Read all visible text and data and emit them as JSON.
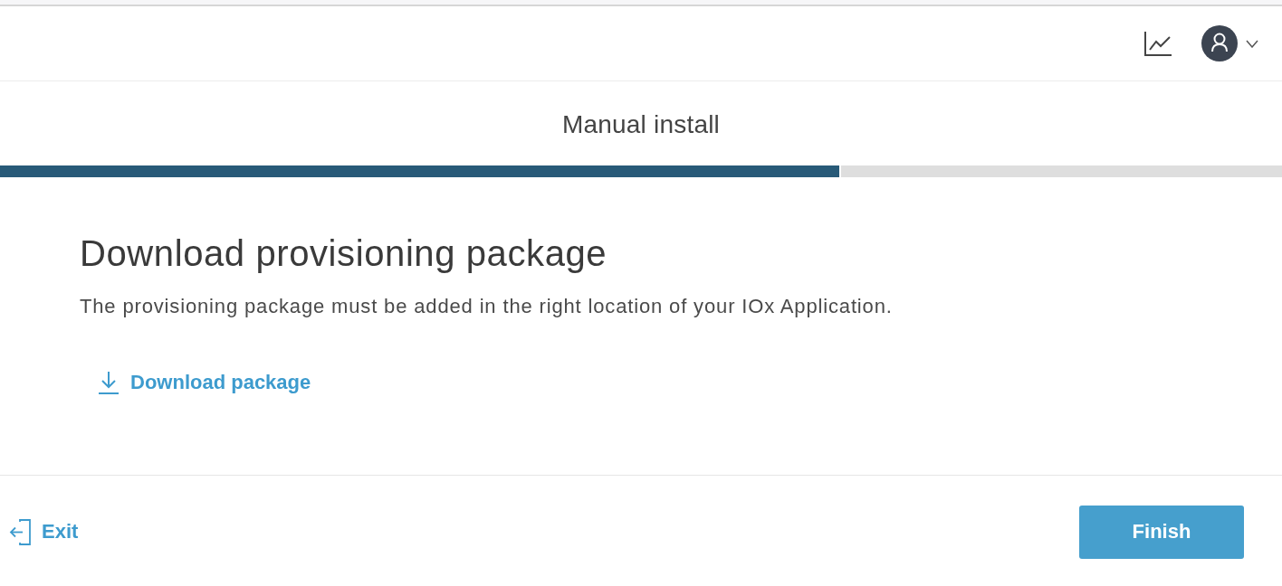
{
  "wizard": {
    "title": "Manual install",
    "progress": {
      "level": 0.656
    }
  },
  "section": {
    "heading": "Download provisioning package",
    "description": "The provisioning package must be added in the right location of your IOx Application.",
    "download_link": "Download package"
  },
  "footer": {
    "exit": "Exit",
    "finish": "Finish"
  }
}
